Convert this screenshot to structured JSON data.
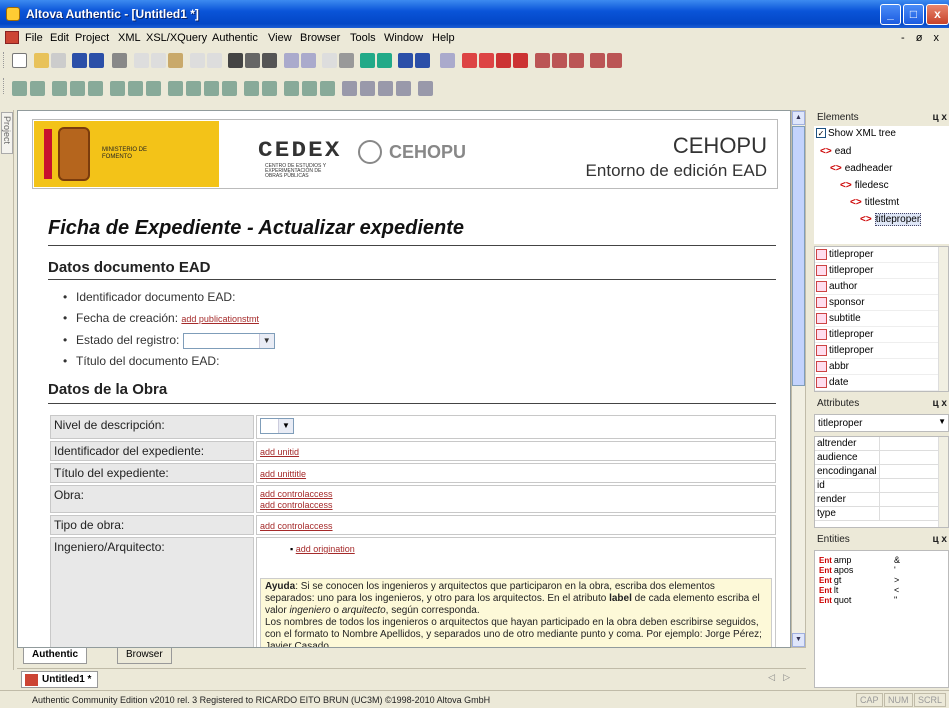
{
  "window": {
    "title": "Altova Authentic - [Untitled1 *]",
    "btn_min": "_",
    "btn_max": "□",
    "btn_close": "x"
  },
  "menu": [
    "File",
    "Edit",
    "Project",
    "XML",
    "XSL/XQuery",
    "Authentic",
    "View",
    "Browser",
    "Tools",
    "Window",
    "Help"
  ],
  "mdi_controls": "- ø x",
  "left_panel_tab": "Project",
  "banner": {
    "ministry": "MINISTERIO DE FOMENTO",
    "cedex": "CEDEX",
    "cedex_sub": "CENTRO DE ESTUDIOS Y EXPERIMENTACIÓN DE OBRAS PÚBLICAS",
    "cehopu_logo": "CEHOPU",
    "title": "CEHOPU",
    "subtitle": "Entorno de edición EAD"
  },
  "doc": {
    "heading": "Ficha de Expediente - Actualizar expediente",
    "section1": "Datos documento EAD",
    "bullets": {
      "b1": "Identificador documento EAD:",
      "b2": "Fecha de creación:",
      "b2_link": "add publicationstmt",
      "b3": "Estado del registro:",
      "b4": "Título del documento EAD:"
    },
    "section2": "Datos de la Obra",
    "table": {
      "r1_label": "Nivel de descripción:",
      "r2_label": "Identificador del expediente:",
      "r2_link": "add unitid",
      "r3_label": "Título del expediente:",
      "r3_link": "add unittitle",
      "r4_label": "Obra:",
      "r4_link1": "add controlaccess",
      "r4_link2": "add controlaccess",
      "r5_label": "Tipo de obra:",
      "r5_link": "add controlaccess",
      "r6_label": "Ingeniero/Arquitecto:",
      "r6_link": "add origination"
    },
    "help": {
      "bold1": "Ayuda",
      "t1": ": Si se conocen los ingenieros y arquitectos que participaron en la obra, escriba dos elementos separados: uno para los ingenieros, y otro para los arquitectos. En el atributo ",
      "bold2": "label",
      "t2": " de cada elemento escriba el valor ",
      "i1": "ingeniero",
      "t3": " o ",
      "i2": "arquitecto",
      "t4": ", según corresponda.",
      "t5": "Los nombres de todos los ingenieros o arquitectos que hayan participado en la obra deben escribirse seguidos, con el formato to Nombre Apellidos, y separados uno de otro mediante punto y coma. Por ejemplo: Jorge Pérez; Javier Casado."
    }
  },
  "view_tabs": [
    "Authentic",
    "Browser"
  ],
  "doc_tab": "Untitled1 *",
  "status": "Authentic Community Edition v2010 rel. 3   Registered to RICARDO EITO BRUN (UC3M)   ©1998-2010 Altova GmbH",
  "status_ind": [
    "CAP",
    "NUM",
    "SCRL"
  ],
  "elements_panel": {
    "title": "Elements",
    "show_tree": "Show XML tree",
    "tree": [
      "ead",
      "eadheader",
      "filedesc",
      "titlestmt",
      "titleproper"
    ],
    "list": [
      "titleproper",
      "titleproper",
      "author",
      "sponsor",
      "subtitle",
      "titleproper",
      "titleproper",
      "abbr",
      "date"
    ]
  },
  "attributes_panel": {
    "title": "Attributes",
    "selected": "titleproper",
    "rows": [
      "altrender",
      "audience",
      "encodinganal",
      "id",
      "render",
      "type"
    ]
  },
  "entities_panel": {
    "title": "Entities",
    "tag": "Ent",
    "rows": [
      {
        "name": "amp",
        "val": "&"
      },
      {
        "name": "apos",
        "val": "'"
      },
      {
        "name": "gt",
        "val": ">"
      },
      {
        "name": "lt",
        "val": "<"
      },
      {
        "name": "quot",
        "val": "\""
      }
    ]
  },
  "panel_close": "ц x"
}
